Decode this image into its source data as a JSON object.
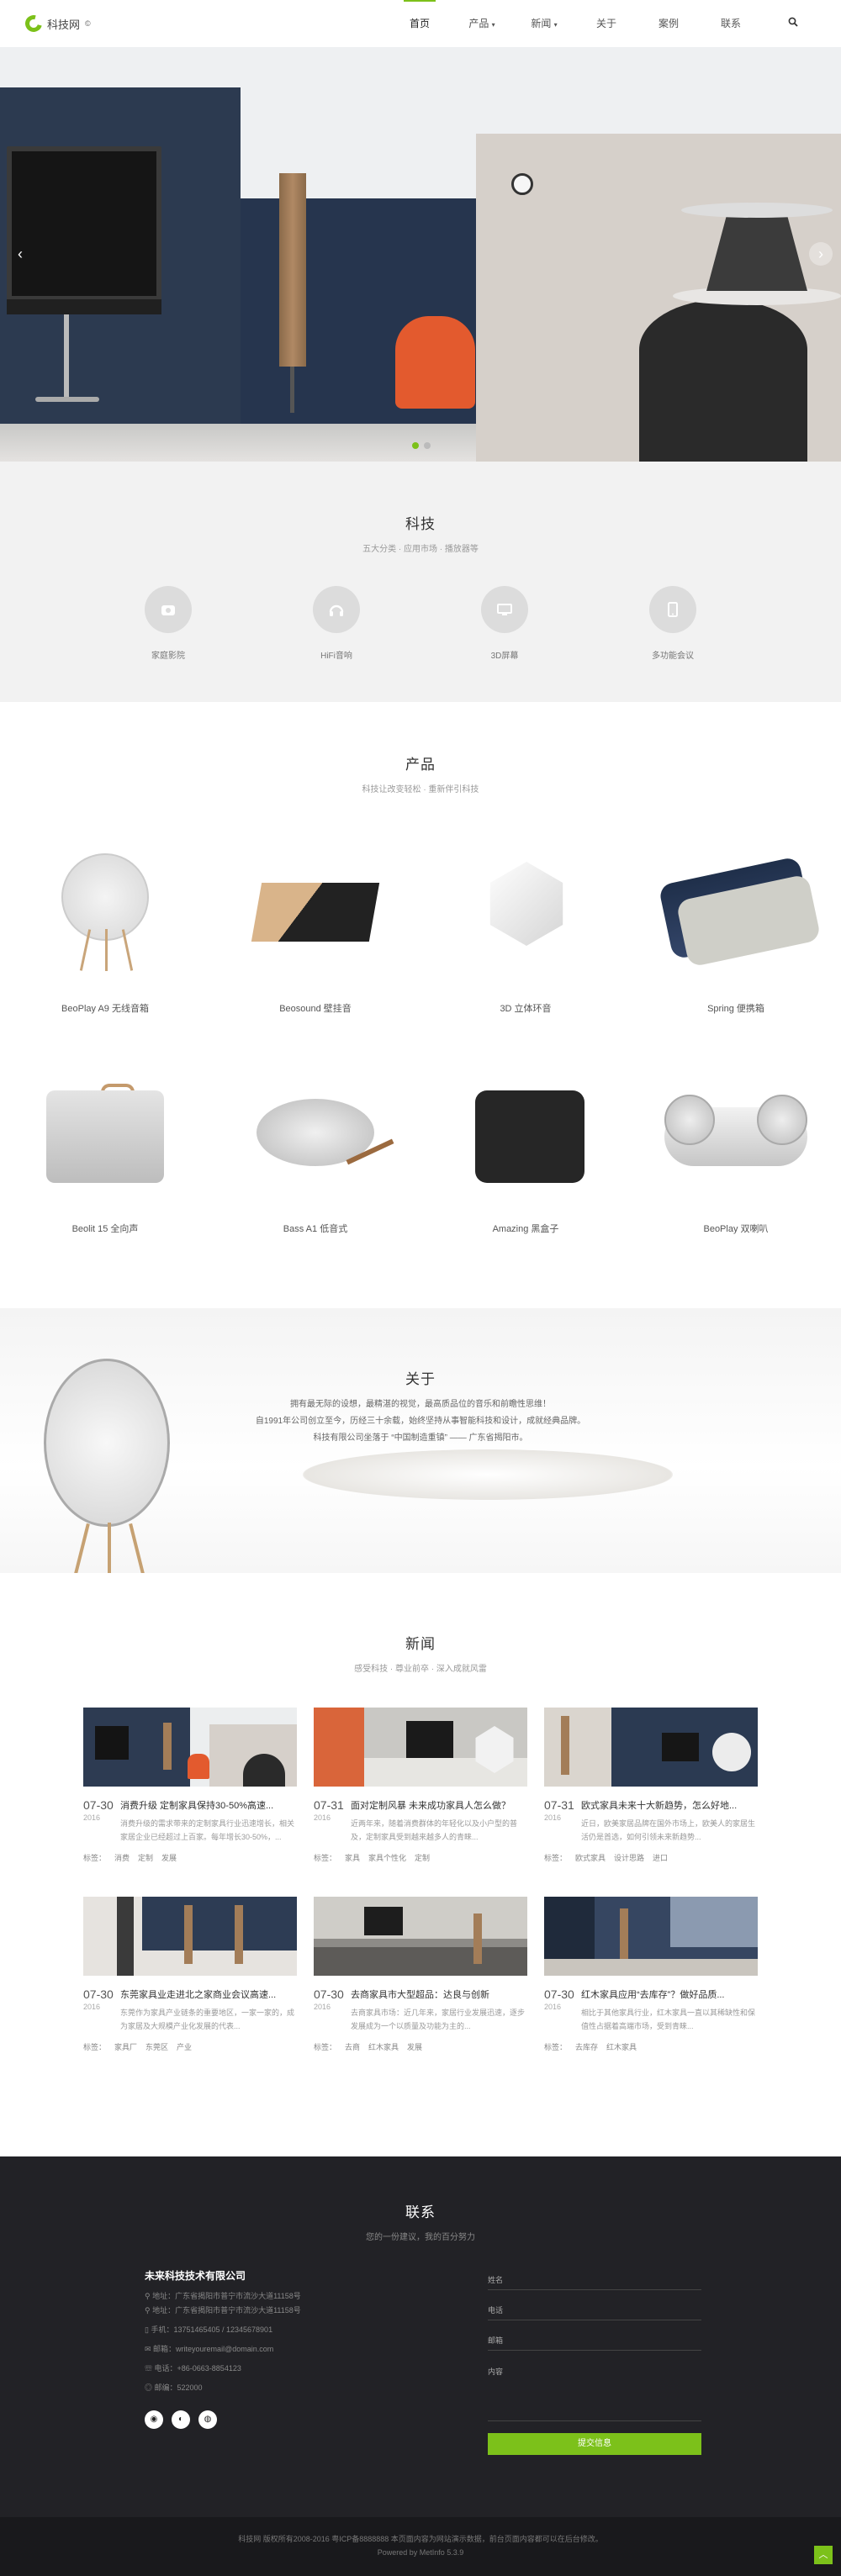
{
  "nav": {
    "brand": "科技网",
    "brand_sup": "©",
    "items": [
      {
        "label": "首页"
      },
      {
        "label": "产品"
      },
      {
        "label": "新闻"
      },
      {
        "label": "关于"
      },
      {
        "label": "案例"
      },
      {
        "label": "联系"
      }
    ]
  },
  "hero": {
    "slide_count": 2,
    "active_slide": 1
  },
  "features": {
    "title": "科技",
    "subtitle": "五大分类 · 应用市场 · 播放器等",
    "items": [
      {
        "label": "家庭影院",
        "icon": "home-theater-icon"
      },
      {
        "label": "HiFi音响",
        "icon": "headphones-icon"
      },
      {
        "label": "3D屏幕",
        "icon": "monitor-icon"
      },
      {
        "label": "多功能会议",
        "icon": "tablet-icon"
      }
    ]
  },
  "products": {
    "title": "产品",
    "subtitle": "科技让改变轻松 · 重新伴引科技",
    "items": [
      {
        "label": "BeoPlay A9 无线音箱"
      },
      {
        "label": "Beosound 壁挂音"
      },
      {
        "label": "3D 立体环音"
      },
      {
        "label": "Spring 便携箱"
      },
      {
        "label": "Beolit 15 全向声"
      },
      {
        "label": "Bass A1 低音式"
      },
      {
        "label": "Amazing 黑盒子"
      },
      {
        "label": "BeoPlay 双喇叭"
      }
    ]
  },
  "about": {
    "title": "关于",
    "lines": [
      "拥有最无际的设想，最精湛的视觉，最高质品位的音乐和前瞻性思维！",
      "自1991年公司创立至今，历经三十余载，始终坚持从事智能科技和设计，成就经典品牌。",
      "科技有限公司坐落于 “中国制造重镇” —— 广东省揭阳市。"
    ]
  },
  "news": {
    "title": "新闻",
    "subtitle": "感受科技 · 尊业前卒 · 深入成就风雷",
    "items": [
      {
        "md": "07-30",
        "year": "2016",
        "title": "消费升级 定制家具保持30-50%高速...",
        "desc": "消费升级的需求带来的定制家具行业迅速增长，相关家居企业已经超过上百家。每年增长30-50%，...",
        "tags": [
          "标签：",
          "消费",
          "定制",
          "发展"
        ]
      },
      {
        "md": "07-31",
        "year": "2016",
        "title": "面对定制风暴 未来成功家具人怎么做？",
        "desc": "近两年来，随着消费群体的年轻化以及小户型的普及，定制家具受到越来越多人的青睐...",
        "tags": [
          "标签：",
          "家具",
          "家具个性化",
          "定制"
        ]
      },
      {
        "md": "07-31",
        "year": "2016",
        "title": "欧式家具未来十大新趋势，怎么好地...",
        "desc": "近日，欧美家居品牌在国外市场上，欧美人的家居生活仍是首选，如何引领未来新趋势...",
        "tags": [
          "标签：",
          "欧式家具",
          "设计思路",
          "进口"
        ]
      },
      {
        "md": "07-30",
        "year": "2016",
        "title": "东莞家具业走进北之家商业会议高速...",
        "desc": "东莞作为家具产业链条的重要地区，一家一家的，成为家居及大规模产业化发展的代表...",
        "tags": [
          "标签：",
          "家具厂",
          "东莞区",
          "产业"
        ]
      },
      {
        "md": "07-30",
        "year": "2016",
        "title": "去商家具市大型超品：达良与创新",
        "desc": "去商家具市场：近几年来，家居行业发展迅速，逐步发展成为一个以质量及功能为主的...",
        "tags": [
          "标签：",
          "去商",
          "红木家具",
          "发展"
        ]
      },
      {
        "md": "07-30",
        "year": "2016",
        "title": "红木家具应用“去库存”？做好品质...",
        "desc": "相比于其他家具行业，红木家具一直以其稀缺性和保值性占据着高端市场，受到青睐...",
        "tags": [
          "标签：",
          "去库存",
          "红木家具"
        ]
      }
    ]
  },
  "contact": {
    "title": "联系",
    "subtitle": "您的一份建议，我的百分努力",
    "company": "未来科技技术有限公司",
    "lines": [
      "地址：广东省揭阳市普宁市流沙大道11158号",
      "地址：广东省揭阳市普宁市流沙大道11158号",
      "手机：13751465405 / 12345678901",
      "邮箱：writeyouremail@domain.com",
      "电话：+86-0663-8854123",
      "邮编：522000"
    ],
    "form": {
      "name": "姓名",
      "phone": "电话",
      "email": "邮箱",
      "content": "内容",
      "submit": "提交信息"
    }
  },
  "footer": {
    "line1": "科技网 版权所有2008-2016 粤ICP备8888888 本页面内容为网站演示数据，前台页面内容都可以在后台修改。",
    "line2": "Powered by MetInfo 5.3.9"
  },
  "colors": {
    "accent": "#7cc11a",
    "dark": "#222226"
  }
}
